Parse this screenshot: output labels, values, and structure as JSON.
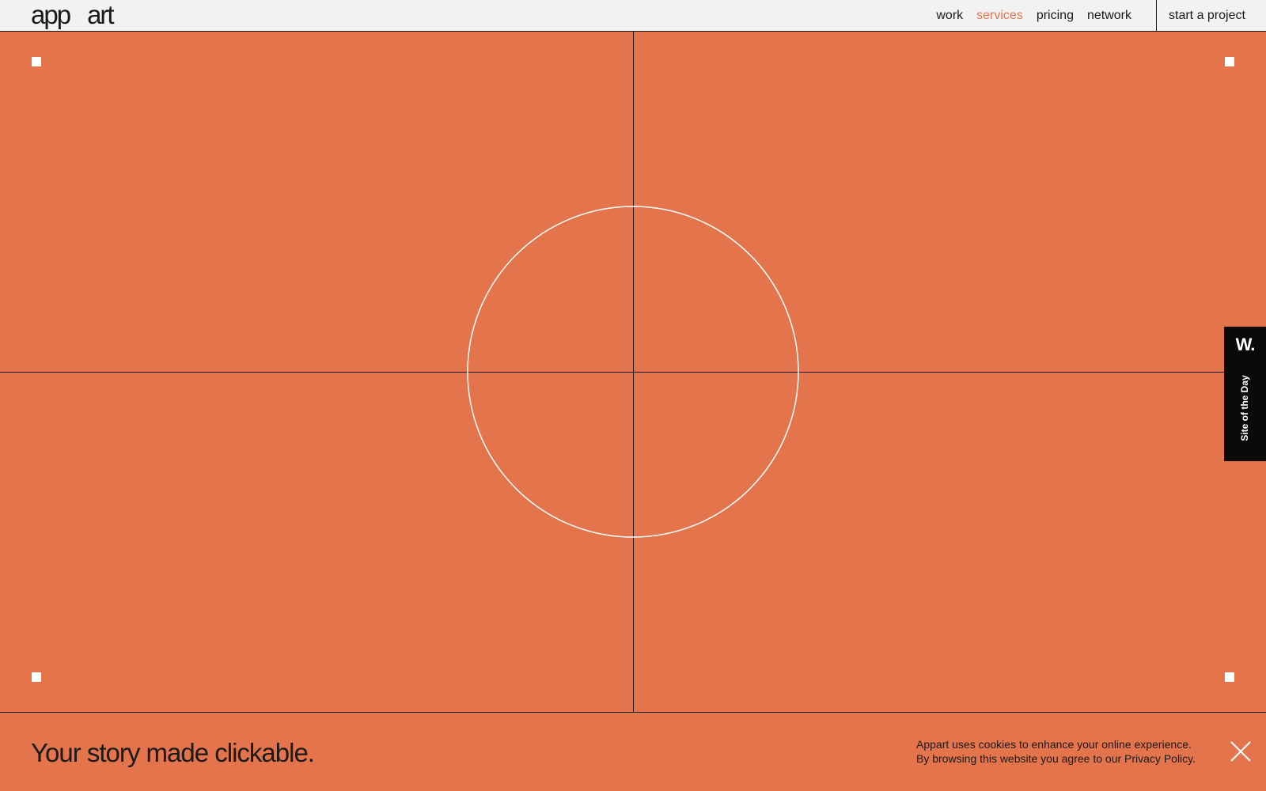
{
  "header": {
    "logo": {
      "part1": "app",
      "part2": "art"
    },
    "nav": [
      {
        "label": "work",
        "active": false
      },
      {
        "label": "services",
        "active": true
      },
      {
        "label": "pricing",
        "active": false
      },
      {
        "label": "network",
        "active": false
      }
    ],
    "cta_label": "start a project"
  },
  "award": {
    "logo_text": "W.",
    "label": "Site of the Day"
  },
  "footer": {
    "tagline": "Your story made clickable.",
    "cookie_line1": "Appart uses cookies to enhance your online experience.",
    "cookie_line2_prefix": "By browsing this website you agree to our ",
    "cookie_link": "Privacy Policy",
    "cookie_line2_suffix": ".",
    "close_icon": "close-icon"
  },
  "colors": {
    "background": "#e3744c",
    "header_bg": "#f2f2f2",
    "accent": "#e3744c",
    "text": "#1a1a1a",
    "award_bg": "#0a0a0a"
  }
}
